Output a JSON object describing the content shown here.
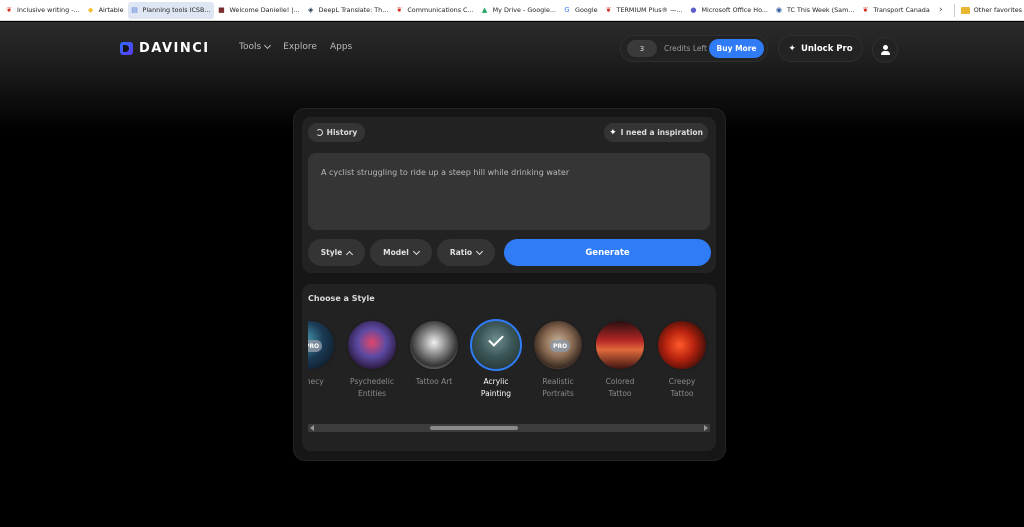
{
  "bookmarks": [
    {
      "label": "Inclusive writing -...",
      "icon": "maple-leaf-icon",
      "color": "#d52b1e"
    },
    {
      "label": "Airtable",
      "icon": "airtable-icon",
      "color": "#f4bf2a"
    },
    {
      "label": "Planning tools ICSB...",
      "icon": "document-icon",
      "color": "#4b7bd6",
      "active": true
    },
    {
      "label": "Welcome Danielle! |...",
      "icon": "app-icon",
      "color": "#7a2e2e"
    },
    {
      "label": "DeepL Translate: Th...",
      "icon": "deepl-icon",
      "color": "#0f2b46"
    },
    {
      "label": "Communications C...",
      "icon": "maple-leaf-icon",
      "color": "#d52b1e"
    },
    {
      "label": "My Drive - Google...",
      "icon": "drive-icon",
      "color": "#1fa463"
    },
    {
      "label": "Google",
      "icon": "google-icon",
      "color": "#4285f4"
    },
    {
      "label": "TERMIUM Plus® —...",
      "icon": "maple-leaf-icon",
      "color": "#d52b1e"
    },
    {
      "label": "Microsoft Office Ho...",
      "icon": "office-icon",
      "color": "#5b5fc7"
    },
    {
      "label": "TC This Week (Sam...",
      "icon": "tc-icon",
      "color": "#2b579a"
    },
    {
      "label": "Transport Canada",
      "icon": "maple-leaf-icon",
      "color": "#d52b1e"
    }
  ],
  "other_favorites": "Other favorites",
  "header": {
    "logo": "DAVINCI",
    "nav": [
      {
        "label": "Tools",
        "has_dropdown": true
      },
      {
        "label": "Explore",
        "has_dropdown": false
      },
      {
        "label": "Apps",
        "has_dropdown": false
      }
    ],
    "credits_count": "3",
    "credits_label": "Credits Left",
    "buy_more": "Buy More",
    "unlock_pro": "Unlock Pro"
  },
  "prompt": {
    "history": "History",
    "inspiration": "I need a inspiration",
    "text": "A cyclist struggling to ride up a steep hill while drinking water",
    "options": [
      {
        "label": "Style",
        "chevron": "up"
      },
      {
        "label": "Model",
        "chevron": "down"
      },
      {
        "label": "Ratio",
        "chevron": "down"
      }
    ],
    "generate": "Generate"
  },
  "styles": {
    "title": "Choose a Style",
    "items": [
      {
        "name": "ophecy",
        "line2": "",
        "pro": true,
        "selected": false
      },
      {
        "name": "Psychedelic",
        "line2": "Entities",
        "pro": false,
        "selected": false
      },
      {
        "name": "Tattoo Art",
        "line2": "",
        "pro": false,
        "selected": false
      },
      {
        "name": "Acrylic",
        "line2": "Painting",
        "pro": false,
        "selected": true
      },
      {
        "name": "Realistic",
        "line2": "Portraits",
        "pro": true,
        "selected": false
      },
      {
        "name": "Colored",
        "line2": "Tattoo",
        "pro": false,
        "selected": false
      },
      {
        "name": "Creepy",
        "line2": "Tattoo",
        "pro": false,
        "selected": false
      }
    ],
    "pro_label": "PRO"
  },
  "colors": {
    "accent": "#2f7cf6",
    "background": "#000000",
    "card": "#222222"
  }
}
